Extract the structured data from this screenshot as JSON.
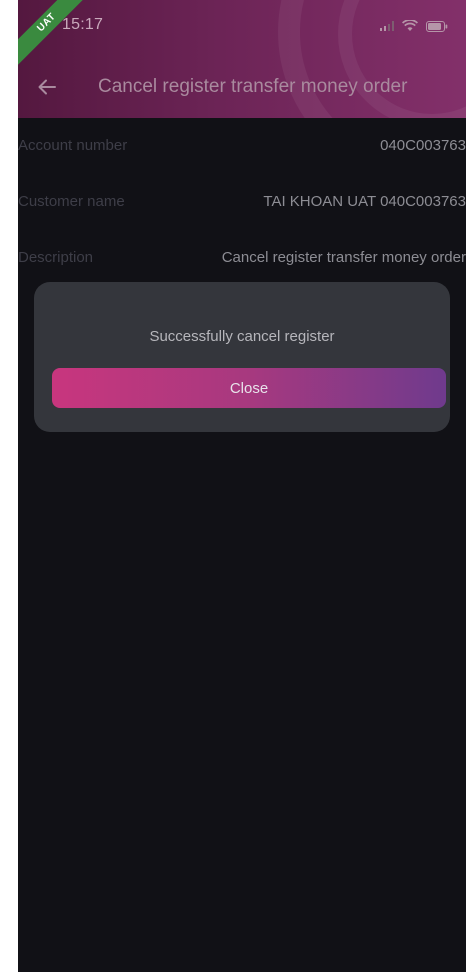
{
  "status_bar": {
    "time": "15:17",
    "env_badge": "UAT",
    "icons": [
      "signal-icon",
      "wifi-icon",
      "battery-icon"
    ]
  },
  "app_bar": {
    "title": "Cancel register transfer money order",
    "back_icon": "arrow-left-icon"
  },
  "details": [
    {
      "label": "Account number",
      "value": "040C003763"
    },
    {
      "label": "Customer name",
      "value": "TAI KHOAN UAT 040C003763"
    },
    {
      "label": "Description",
      "value": "Cancel register transfer money order"
    }
  ],
  "dialog": {
    "message": "Successfully cancel register",
    "close_label": "Close"
  },
  "colors": {
    "background": "#111116",
    "header_gradient_start": "#54183f",
    "header_gradient_end": "#83306a",
    "dialog_background": "#34363c",
    "button_gradient_start": "#c8367e",
    "button_gradient_end": "#6f3a8d",
    "uat_badge": "#3a8a3f"
  }
}
